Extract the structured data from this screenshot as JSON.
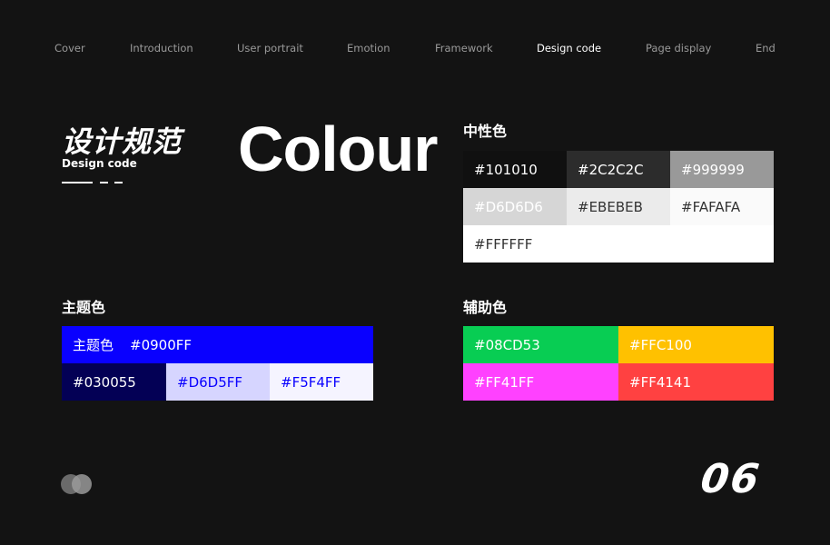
{
  "nav": {
    "items": [
      "Cover",
      "Introduction",
      "User portrait",
      "Emotion",
      "Framework",
      "Design code",
      "Page display",
      "End"
    ],
    "active": "Design code"
  },
  "header": {
    "title_cn": "设计规范",
    "subtitle_en": "Design code",
    "big_word": "Colour"
  },
  "neutral": {
    "title": "中性色",
    "swatches": [
      {
        "hex": "#101010",
        "text_color": "#ffffff"
      },
      {
        "hex": "#2C2C2C",
        "text_color": "#ffffff"
      },
      {
        "hex": "#999999",
        "text_color": "#ffffff"
      },
      {
        "hex": "#D6D6D6",
        "text_color": "#ffffff"
      },
      {
        "hex": "#EBEBEB",
        "text_color": "#333333"
      },
      {
        "hex": "#FAFAFA",
        "text_color": "#333333"
      },
      {
        "hex": "#FFFFFF",
        "text_color": "#333333"
      }
    ]
  },
  "theme": {
    "title": "主题色",
    "main_label": "主题色",
    "swatches": [
      {
        "hex": "#0900FF",
        "text_color": "#ffffff"
      },
      {
        "hex": "#030055",
        "text_color": "#ffffff"
      },
      {
        "hex": "#D6D5FF",
        "text_color": "#0900FF"
      },
      {
        "hex": "#F5F4FF",
        "text_color": "#0900FF"
      }
    ]
  },
  "auxiliary": {
    "title": "辅助色",
    "swatches": [
      {
        "hex": "#08CD53",
        "text_color": "#ffffff"
      },
      {
        "hex": "#FFC100",
        "text_color": "#ffffff"
      },
      {
        "hex": "#FF41FF",
        "text_color": "#ffffff"
      },
      {
        "hex": "#FF4141",
        "text_color": "#ffffff"
      }
    ]
  },
  "footer": {
    "page_number": "06"
  },
  "colors": {
    "background": "#131313",
    "nav_inactive": "#9a9a9a",
    "nav_active": "#ffffff"
  }
}
